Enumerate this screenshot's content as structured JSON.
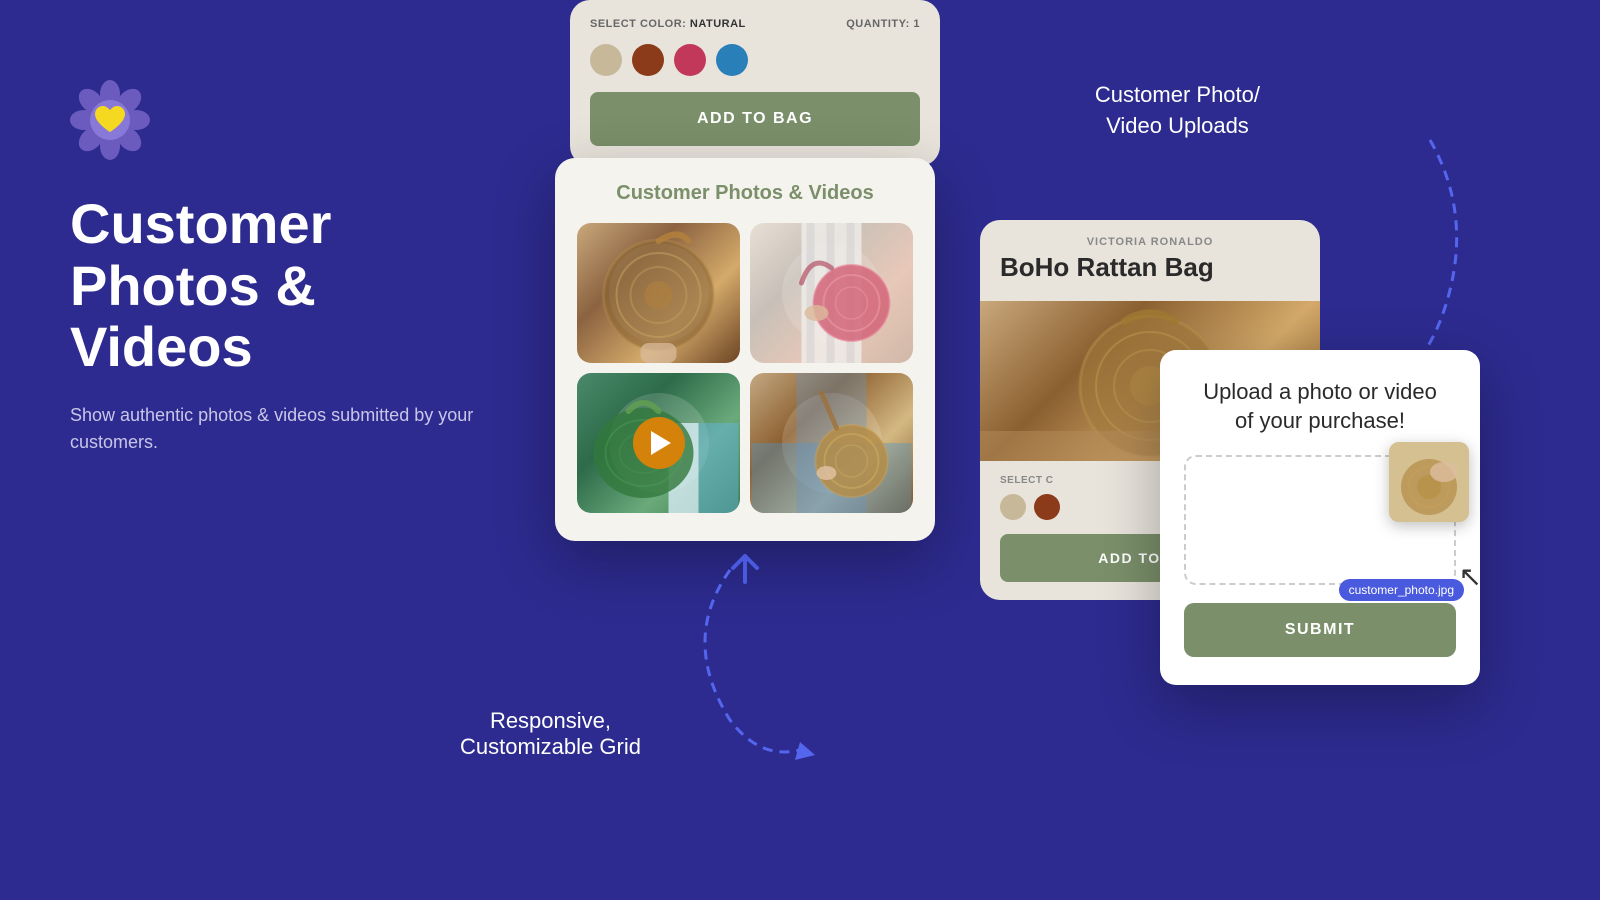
{
  "background_color": "#2d2b8f",
  "logo": {
    "aria": "flower-logo"
  },
  "left": {
    "heading_line1": "Customer",
    "heading_line2": "Photos & Videos",
    "description": "Show authentic photos & videos\nsubmitted by your customers."
  },
  "product_widget_top": {
    "color_label": "SELECT COLOR:",
    "color_name": "NATURAL",
    "quantity_label": "QUANTITY:",
    "quantity_value": "1",
    "swatches": [
      {
        "name": "beige",
        "color": "#c8b89a"
      },
      {
        "name": "brown",
        "color": "#8b3a1a"
      },
      {
        "name": "pink",
        "color": "#c2385a"
      },
      {
        "name": "blue",
        "color": "#2980b9"
      }
    ],
    "add_to_bag_label": "ADD TO BAG"
  },
  "photos_card": {
    "title": "Customer Photos & Videos",
    "photos": [
      {
        "label": "rattan-round-bag",
        "has_video": false
      },
      {
        "label": "pink-shoulder-bag",
        "has_video": false
      },
      {
        "label": "green-wicker-bag",
        "has_video": true
      },
      {
        "label": "wicker-side-bag",
        "has_video": false
      }
    ]
  },
  "labels": {
    "responsive_grid": "Responsive,\nCustomizable Grid",
    "customer_photo_upload": "Customer Photo/\nVideo Uploads"
  },
  "right_product_card": {
    "seller_name": "VICTORIA RONALDO",
    "product_name": "BoHo Rattan Bag",
    "color_label": "SELECT C",
    "swatches": [
      {
        "name": "beige",
        "color": "#c8b89a"
      },
      {
        "name": "brown",
        "color": "#8b3a1a"
      }
    ],
    "add_to_bag_label": "ADD TO BAG"
  },
  "upload_modal": {
    "title": "Upload a photo or video\nof your purchase!",
    "filename": "customer_photo.jpg",
    "submit_label": "SUBMIT"
  }
}
